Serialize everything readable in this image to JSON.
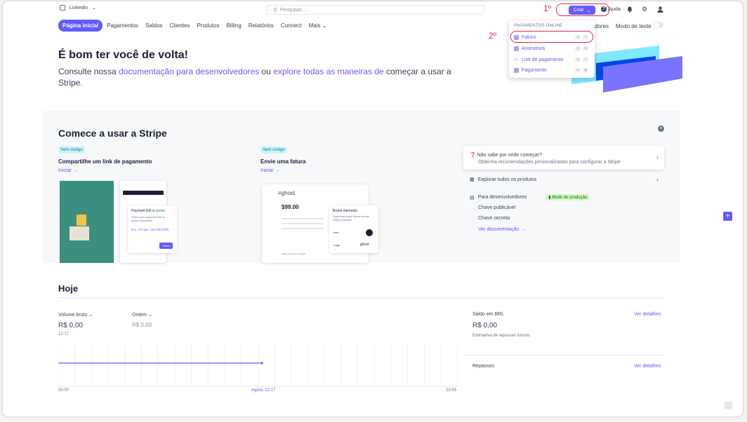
{
  "topbar": {
    "account": "Linkedin",
    "search_placeholder": "Pesquisar...",
    "create_label": "Criar",
    "help_label": "Ajuda",
    "annotation_1": "1º",
    "annotation_2": "2º"
  },
  "nav": {
    "items": [
      "Página inicial",
      "Pagamentos",
      "Saldos",
      "Clientes",
      "Produtos",
      "Billing",
      "Relatórios",
      "Connect",
      "Mais"
    ],
    "dev_label_partial": "dores",
    "test_mode_label": "Modo de teste"
  },
  "create_menu": {
    "header": "PAGAMENTOS ONLINE",
    "items": [
      {
        "label": "Fatura",
        "keys": [
          "c",
          "i"
        ]
      },
      {
        "label": "Assinatura",
        "keys": [
          "c",
          "s"
        ]
      },
      {
        "label": "Link de pagamento",
        "keys": [
          "c",
          "l"
        ]
      },
      {
        "label": "Pagamento",
        "keys": [
          "c",
          "p"
        ]
      }
    ]
  },
  "welcome": {
    "title": "É bom ter você de volta!",
    "text_1": "Consulte nossa ",
    "link_1": "documentação para desenvolvedores",
    "text_2": " ou ",
    "link_2": "explore todas as maneiras de",
    "text_3": " começar a usar a Stripe."
  },
  "get_started": {
    "title": "Comece a usar a Stripe",
    "cards": [
      {
        "badge": "Sem código",
        "title": "Compartilhe um link de pagamento",
        "cta": "Iniciar"
      },
      {
        "badge": "Sem código",
        "title": "Envie uma fatura",
        "cta": "Iniciar"
      }
    ],
    "illustration": {
      "paylink_title": "Payment link is ",
      "paylink_status": "active",
      "paylink_desc": "Share your payment link to accept payments",
      "paylink_url": "buy.stripe.com/a0Ja240",
      "paylink_button": "Share",
      "price": "$99.00",
      "ghost_logo": "ghost",
      "brand_title": "Brand elements",
      "brand_desc": "Customize your brand across Stripe products",
      "brand_icon": "Icon",
      "brand_logo": "Logo",
      "brand_logo_value": "ghost",
      "payment_method": "Select a payment method"
    },
    "help": {
      "title": "Não sabe por onde começar?",
      "desc": "Obtenha recomendações personalizadas para configurar a Stripe"
    },
    "explore": "Explorar todos os produtos",
    "dev": {
      "title": "Para desenvolvedores",
      "mode_badge": "Modo de produção",
      "publishable": "Chave publicável",
      "secret": "Chave secreta",
      "docs_link": "Ver documentação"
    }
  },
  "today": {
    "title": "Hoje",
    "gross_label": "Volume bruto",
    "gross_value": "R$ 0,00",
    "gross_time": "12:17",
    "yesterday_label": "Ontem",
    "yesterday_value": "R$ 0,00",
    "axis_start": "00:00",
    "axis_now": "Agora, 12:17",
    "axis_end": "23:59",
    "balance_label": "Saldo em BRL",
    "balance_value": "R$ 0,00",
    "balance_note": "Estimativa de repasses futuros",
    "payouts_label": "Repasses",
    "details_link": "Ver detalhes"
  },
  "colors": {
    "accent": "#635bff",
    "annotation": "#e0294a"
  }
}
